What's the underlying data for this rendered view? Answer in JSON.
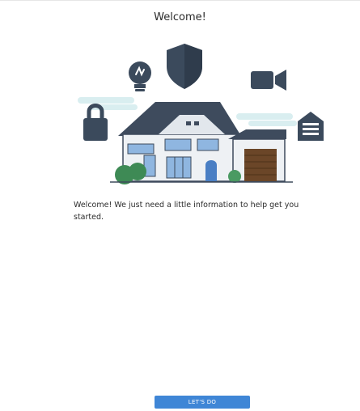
{
  "header": {
    "title": "Welcome!"
  },
  "illustration": {
    "icons": [
      "lightbulb-icon",
      "shield-icon",
      "video-camera-icon",
      "padlock-icon",
      "garage-icon",
      "house-icon"
    ],
    "colors": {
      "icon_dark": "#3b4a5c",
      "roof": "#3e4b5d",
      "wall": "#eef1f4",
      "window": "#8fb6e0",
      "door": "#4a7fc4",
      "garage_door": "#6b4628",
      "bush": "#3e8a55",
      "cloud": "#cfe7ea"
    }
  },
  "main": {
    "intro_text": "Welcome! We just need a little information to help get you started."
  },
  "footer": {
    "cta_label": "LET'S DO",
    "cta_color": "#3f86d6"
  }
}
